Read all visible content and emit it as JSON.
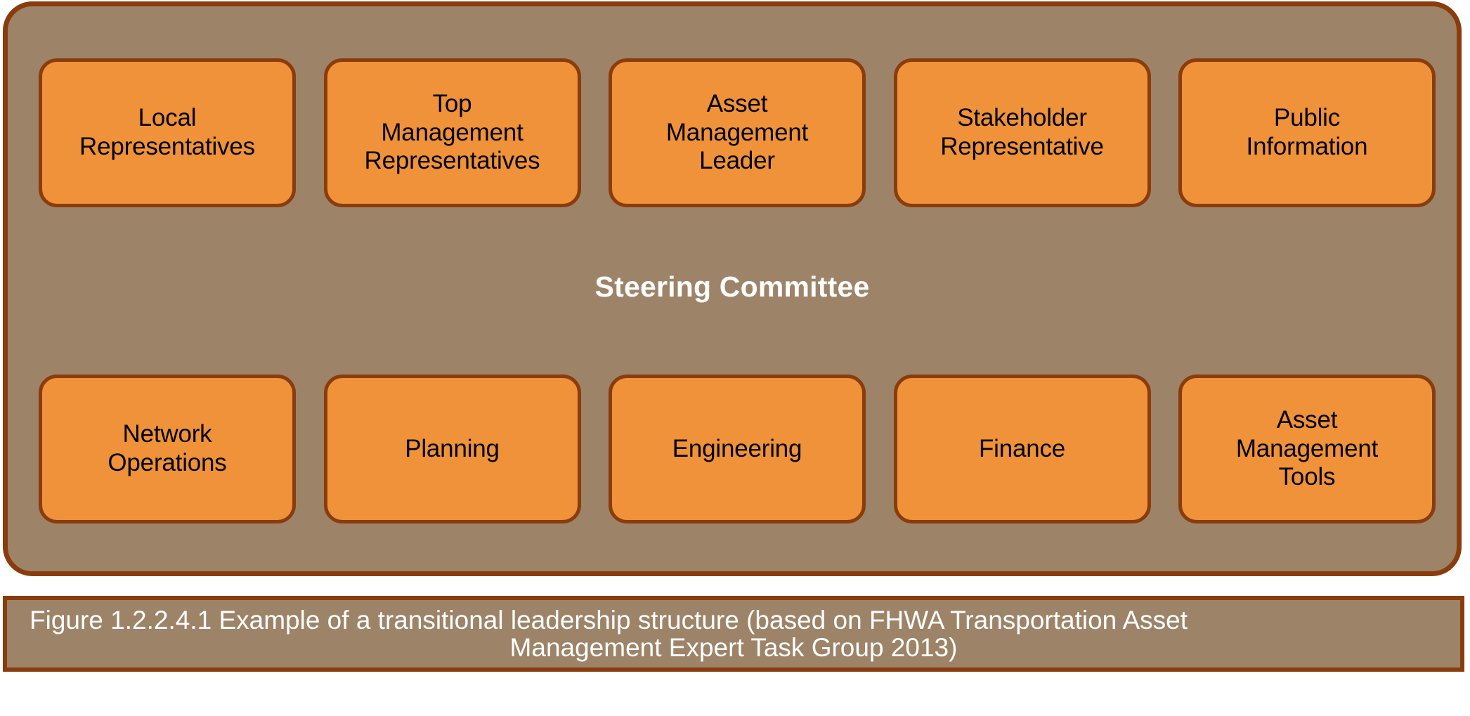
{
  "figure": {
    "container_title": "Steering Committee",
    "colors": {
      "container_fill": "#9d8468",
      "box_fill": "#ef9239",
      "border": "#8a3c0c",
      "title_text": "#ffffff",
      "box_text": "#000000",
      "caption_text": "#ffffff",
      "page_background": "#ffffff"
    },
    "top_row": [
      {
        "label": "Local\nRepresentatives"
      },
      {
        "label": "Top\nManagement\nRepresentatives"
      },
      {
        "label": "Asset\nManagement\nLeader"
      },
      {
        "label": "Stakeholder\nRepresentative"
      },
      {
        "label": "Public\nInformation"
      }
    ],
    "bottom_row": [
      {
        "label": "Network\nOperations"
      },
      {
        "label": "Planning"
      },
      {
        "label": "Engineering"
      },
      {
        "label": "Finance"
      },
      {
        "label": "Asset\nManagement\nTools"
      }
    ],
    "caption": {
      "full": "Figure 1.2.2.4.1 Example of a transitional leadership structure (based on FHWA Transportation Asset Management Expert Task Group 2013)",
      "line1": "Figure 1.2.2.4.1 Example of a transitional leadership structure (based on FHWA Transportation Asset",
      "line2": "Management Expert Task Group 2013)",
      "figure_number": "1.2.2.4.1",
      "source": "FHWA Transportation Asset Management Expert Task Group 2013"
    }
  }
}
